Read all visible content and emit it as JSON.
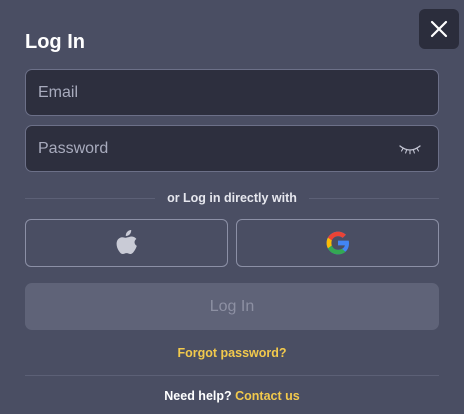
{
  "dialog": {
    "title": "Log In",
    "close_icon": "close-icon"
  },
  "email": {
    "placeholder": "Email",
    "value": ""
  },
  "password": {
    "placeholder": "Password",
    "value": "",
    "toggle_icon": "eye-closed-icon"
  },
  "divider_text": "or Log in directly with",
  "social": {
    "apple_icon": "apple-icon",
    "google_icon": "google-icon"
  },
  "login_button": "Log In",
  "forgot_password": "Forgot password?",
  "help": {
    "text": "Need help?",
    "link": "Contact us"
  },
  "colors": {
    "background": "#4a4e63",
    "field_bg": "#2d2f3e",
    "accent": "#f2c94c",
    "login_disabled_bg": "#5f6378",
    "login_disabled_text": "#8d90a3"
  }
}
